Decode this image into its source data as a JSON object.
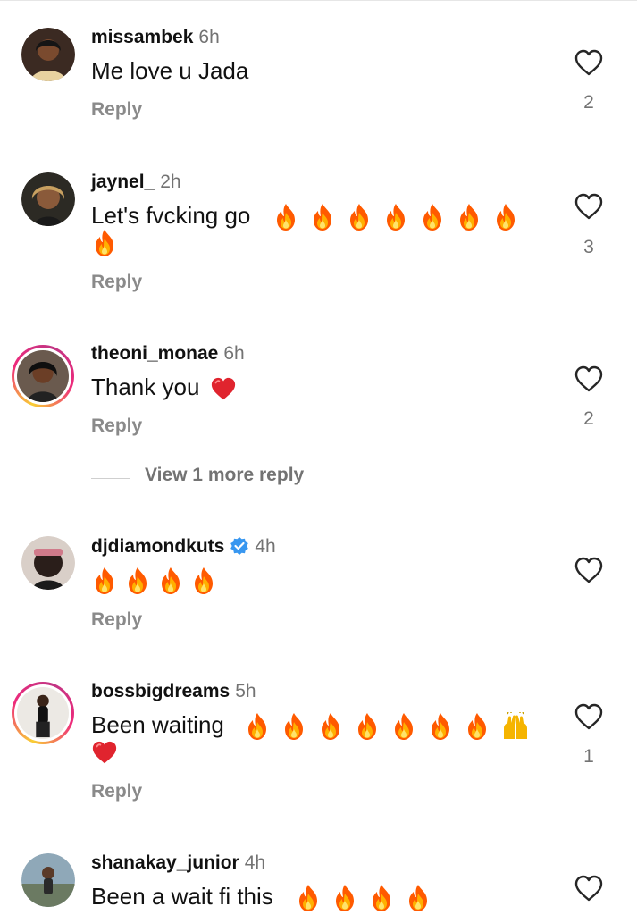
{
  "comments": [
    {
      "username": "missambek",
      "time": "6h",
      "text": "Me love u Jada",
      "reply": "Reply",
      "likes": "2",
      "avatar_icon": "user-avatar",
      "verified": false
    },
    {
      "username": "jaynel_",
      "time": "2h",
      "text": "Let's fvcking go",
      "emojis": "🔥🔥🔥🔥🔥🔥🔥🔥",
      "reply": "Reply",
      "likes": "3",
      "avatar_icon": "user-avatar",
      "verified": false
    },
    {
      "username": "theoni_monae",
      "time": "6h",
      "text": "Thank you",
      "emojis": "❤️",
      "reply": "Reply",
      "likes": "2",
      "avatar_icon": "user-avatar-story-ring",
      "verified": false
    },
    {
      "username": "djdiamondkuts",
      "time": "4h",
      "emojis": "🔥🔥🔥🔥",
      "reply": "Reply",
      "likes": "",
      "avatar_icon": "user-avatar",
      "verified": true
    },
    {
      "username": "bossbigdreams",
      "time": "5h",
      "text": "Been waiting",
      "emojis": "🔥🔥🔥🔥🔥🔥🔥🙌❤️",
      "reply": "Reply",
      "likes": "1",
      "avatar_icon": "user-avatar-story-ring",
      "verified": false
    },
    {
      "username": "shanakay_junior",
      "time": "4h",
      "text": "Been a wait fi this",
      "emojis": "🔥🔥🔥🔥",
      "likes": "",
      "avatar_icon": "user-avatar",
      "verified": false
    }
  ],
  "view_more": {
    "label": "View 1 more reply"
  },
  "icons": {
    "like": "heart-outline-icon",
    "verified": "verified-badge-icon"
  },
  "colors": {
    "username": "#111111",
    "meta": "#737373",
    "reply": "#8a8a8a",
    "verified": "#3897f0",
    "fire": "#ff7a00",
    "heart": "#e0242e"
  }
}
